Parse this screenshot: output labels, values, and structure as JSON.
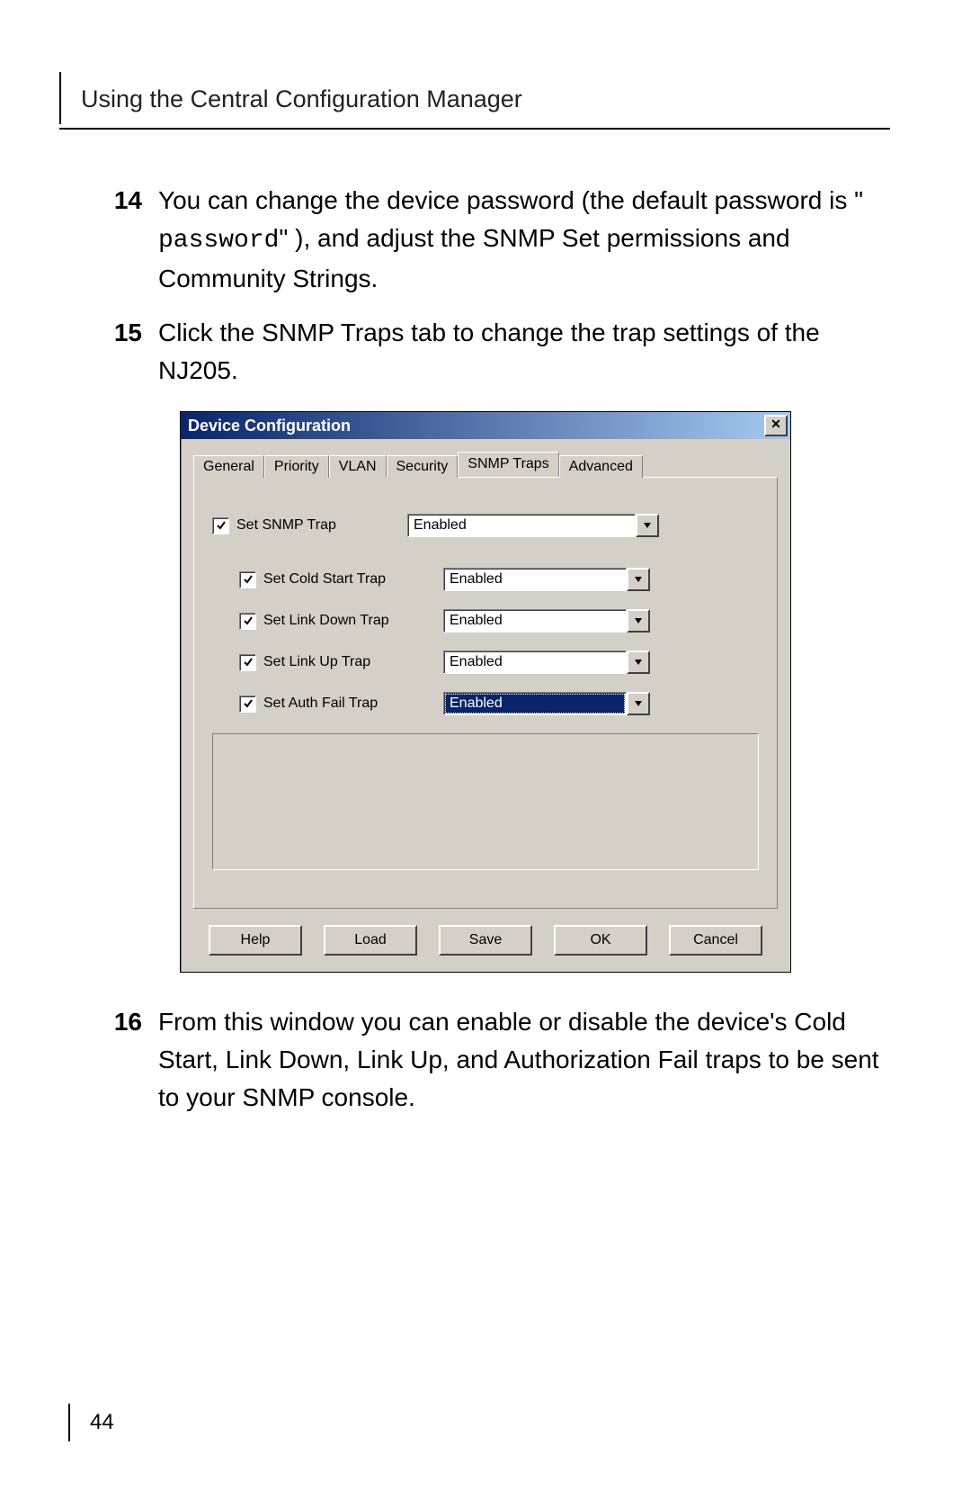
{
  "header": {
    "title": "Using the Central Configuration Manager",
    "page_number": "44"
  },
  "steps": {
    "s14": {
      "num": "14",
      "text_a": "You can change the device password (the default password is \" ",
      "code": "password",
      "text_b": "\" ), and adjust the SNMP Set permissions and Community Strings."
    },
    "s15": {
      "num": "15",
      "text": "Click the SNMP Traps tab to change the trap settings of the NJ205."
    },
    "s16": {
      "num": "16",
      "text": "From this window you can enable or disable the device's Cold Start, Link Down, Link Up, and Authorization Fail traps to be sent to your SNMP console."
    }
  },
  "dialog": {
    "title": "Device Configuration",
    "close": "×",
    "tabs": {
      "general": "General",
      "priority": "Priority",
      "vlan": "VLAN",
      "security": "Security",
      "snmp": "SNMP Traps",
      "advanced": "Advanced"
    },
    "traps": {
      "main": {
        "label": "Set SNMP Trap",
        "value": "Enabled"
      },
      "cold": {
        "label": "Set Cold Start Trap",
        "value": "Enabled"
      },
      "linkdown": {
        "label": "Set Link Down Trap",
        "value": "Enabled"
      },
      "linkup": {
        "label": "Set Link Up Trap",
        "value": "Enabled"
      },
      "auth": {
        "label": "Set Auth Fail Trap",
        "value": "Enabled"
      }
    },
    "buttons": {
      "help": "Help",
      "load": "Load",
      "save": "Save",
      "ok": "OK",
      "cancel": "Cancel"
    }
  }
}
